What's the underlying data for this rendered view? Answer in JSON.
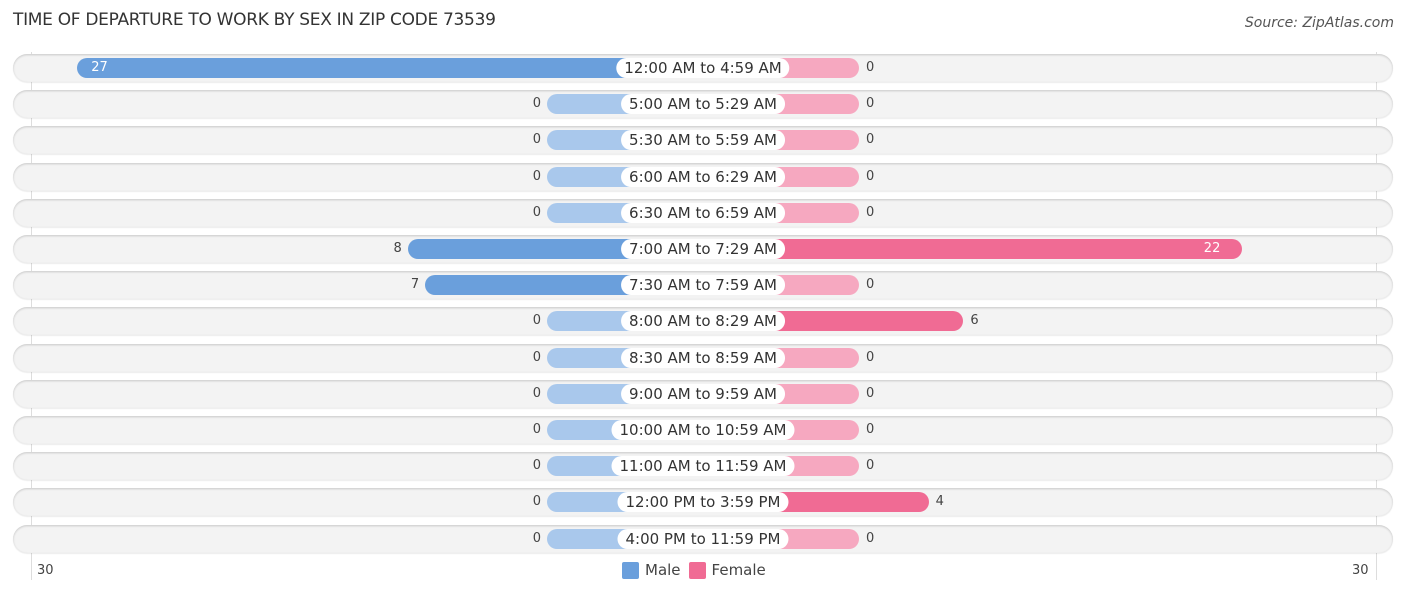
{
  "title": "TIME OF DEPARTURE TO WORK BY SEX IN ZIP CODE 73539",
  "source": "Source: ZipAtlas.com",
  "colors": {
    "male": "#6a9fdc",
    "male_light": "#a9c8ec",
    "female": "#f06b94",
    "female_light": "#f6a8c0"
  },
  "chart_data": {
    "type": "bar",
    "orientation": "horizontal-diverging",
    "title": "TIME OF DEPARTURE TO WORK BY SEX IN ZIP CODE 73539",
    "categories": [
      "12:00 AM to 4:59 AM",
      "5:00 AM to 5:29 AM",
      "5:30 AM to 5:59 AM",
      "6:00 AM to 6:29 AM",
      "6:30 AM to 6:59 AM",
      "7:00 AM to 7:29 AM",
      "7:30 AM to 7:59 AM",
      "8:00 AM to 8:29 AM",
      "8:30 AM to 8:59 AM",
      "9:00 AM to 9:59 AM",
      "10:00 AM to 10:59 AM",
      "11:00 AM to 11:59 AM",
      "12:00 PM to 3:59 PM",
      "4:00 PM to 11:59 PM"
    ],
    "series": [
      {
        "name": "Male",
        "values": [
          27,
          0,
          0,
          0,
          0,
          8,
          7,
          0,
          0,
          0,
          0,
          0,
          0,
          0
        ]
      },
      {
        "name": "Female",
        "values": [
          0,
          0,
          0,
          0,
          0,
          22,
          0,
          6,
          0,
          0,
          0,
          0,
          4,
          0
        ]
      }
    ],
    "axis": {
      "left_tick": "30",
      "right_tick": "30",
      "range": [
        -30,
        30
      ]
    },
    "legend": [
      "Male",
      "Female"
    ],
    "legend_position": "bottom-center"
  }
}
